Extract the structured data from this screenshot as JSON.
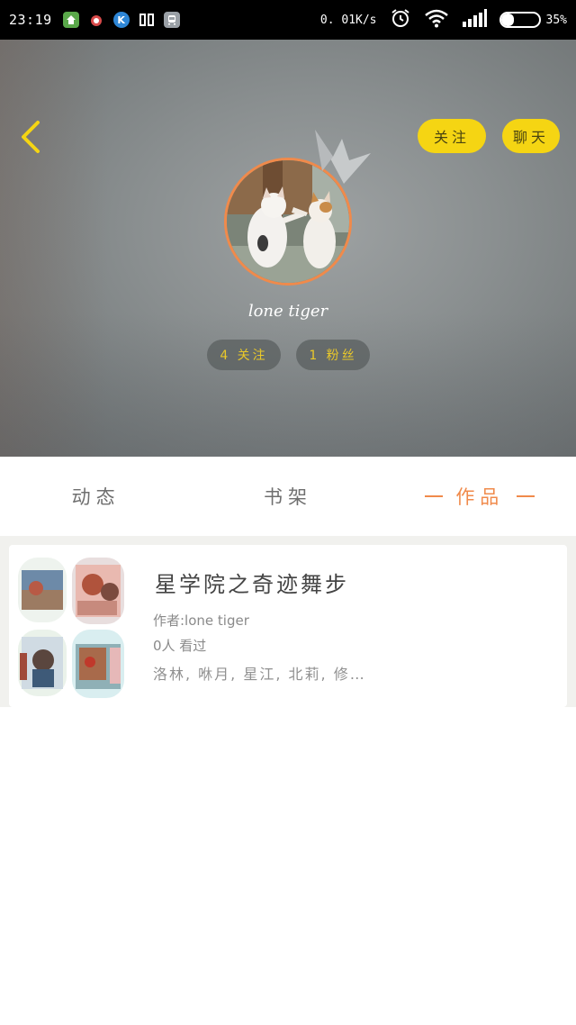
{
  "status_bar": {
    "time": "23:19",
    "app_icons": [
      {
        "name": "home-icon",
        "color": "#5aa84a"
      },
      {
        "name": "bug-icon",
        "color": "#d84a4a"
      },
      {
        "name": "k-app-icon",
        "color": "#2e86d6",
        "glyph": "K"
      },
      {
        "name": "book-icon",
        "color": "#e0e0e0"
      },
      {
        "name": "train-icon",
        "color": "#9aa0a6"
      }
    ],
    "network_speed": "0. 01K/s",
    "battery_percent": "35%",
    "battery_level": 0.35
  },
  "header": {
    "follow_label": "关注",
    "chat_label": "聊天",
    "username": "lone tiger",
    "following_label": "4 关注",
    "fans_label": "1 粉丝",
    "accent_color": "#f5d513",
    "avatar_ring_color": "#f08a4b"
  },
  "tabs": {
    "items": [
      {
        "label": "动态",
        "active": false
      },
      {
        "label": "书架",
        "active": false
      },
      {
        "label": "作品",
        "active": true
      }
    ]
  },
  "works": [
    {
      "title": "星学院之奇迹舞步",
      "author": "作者:lone tiger",
      "views": "0人 看过",
      "characters": "洛林, 咻月, 星江, 北莉, 修…"
    }
  ]
}
